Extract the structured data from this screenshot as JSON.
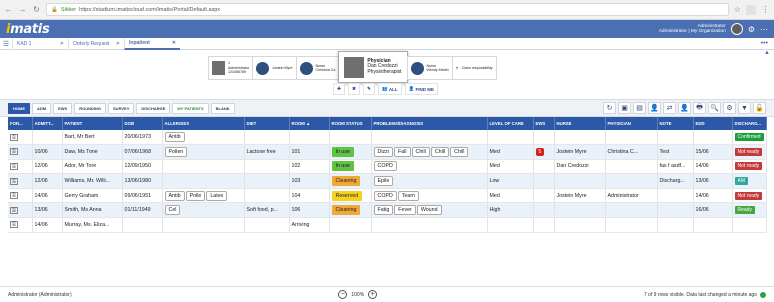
{
  "browser": {
    "secure_label": "Sikker",
    "url": "https://stadium.imatiscloud.com/Imatis/Portal/Default.aspx"
  },
  "app": {
    "logo_first": "i",
    "logo_rest": "matis",
    "user_name": "Administrator",
    "user_org": "Administrator | My Organization"
  },
  "tabs": [
    {
      "label": "KAD 1"
    },
    {
      "label": "Orderly Request"
    },
    {
      "label": "Inpatient"
    }
  ],
  "cards": [
    {
      "line1": "1",
      "line2": "Administrator",
      "line3": "123456789"
    },
    {
      "line1": "Jostein Myre",
      "line2": "",
      "line3": ""
    },
    {
      "line1": "Nurse",
      "line2": "Christina Ca",
      "line3": ""
    },
    {
      "line1": "Physician",
      "line2": "Dan Credozzi",
      "line3": "Physiotherapist"
    },
    {
      "line1": "Nurse",
      "line2": "Wendy Martin",
      "line3": ""
    },
    {
      "line1": "Claim responsibility",
      "line2": "",
      "line3": ""
    }
  ],
  "actions": {
    "all_label": "ALL",
    "find_label": "FIND ME"
  },
  "views": [
    "HOME",
    "ADM",
    "EWS",
    "ROUNDING",
    "SURVEY",
    "DISCHARGE",
    "MY PATIENTS",
    "BLANK"
  ],
  "columns": [
    "FOR...",
    "ADMITT...",
    "PATIENT",
    "DOB",
    "ALLERGIES",
    "DIET",
    "ROOM",
    "ROOM STATUS",
    "PROBLEMS/DIAGNOSIS",
    "LEVEL OF CARE",
    "EWS",
    "NURSE",
    "PHYSICIAN",
    "NOTE",
    "EDD",
    "DISCHARG..."
  ],
  "rows": [
    {
      "admitted": "",
      "patient": "Bart, Mr Bert",
      "dob": "20/06/1973",
      "allergies": [
        "Antib"
      ],
      "diet": "",
      "room": "",
      "room_status": "",
      "problems": [],
      "level": "",
      "ews": "",
      "nurse": "",
      "physician": "",
      "note": "",
      "edd": "",
      "discharge": "Confirmed"
    },
    {
      "admitted": "10/06",
      "patient": "Daw, Ms Tone",
      "dob": "07/06/1968",
      "allergies": [
        "Pollen"
      ],
      "diet": "Lactose free",
      "room": "101",
      "room_status": "In use",
      "problems": [
        "Dizzi",
        "Fall",
        "Chill",
        "Chill",
        "Chill"
      ],
      "level": "Med",
      "ews": "5",
      "nurse": "Jostein Myre",
      "physician": "Christina C...",
      "note": "Test",
      "edd": "15/06",
      "discharge": "Not ready"
    },
    {
      "admitted": "12/06",
      "patient": "Ador, Mr Tore",
      "dob": "12/09/1950",
      "allergies": [],
      "diet": "",
      "room": "102",
      "room_status": "In use",
      "problems": [
        "COPD"
      ],
      "level": "Med",
      "ews": "",
      "nurse": "Dan Credozzi",
      "physician": "",
      "note": "fas f asdf...",
      "edd": "14/06",
      "discharge": "Not ready"
    },
    {
      "admitted": "12/06",
      "patient": "Williams, Mr. Willi...",
      "dob": "13/06/1980",
      "allergies": [],
      "diet": "",
      "room": "103",
      "room_status": "Cleaning",
      "problems": [
        "Epile"
      ],
      "level": "Low",
      "ews": "",
      "nurse": "",
      "physician": "",
      "note": "Discharg...",
      "edd": "13/06",
      "discharge": "AM"
    },
    {
      "admitted": "14/06",
      "patient": "Gerry Graham",
      "dob": "09/06/1951",
      "allergies": [
        "Antib",
        "Polle",
        "Latex"
      ],
      "diet": "",
      "room": "104",
      "room_status": "Reserved",
      "problems": [
        "COPD",
        "Team"
      ],
      "level": "Med",
      "ews": "",
      "nurse": "Jostein Myre",
      "physician": "Administrator",
      "note": "",
      "edd": "14/06",
      "discharge": "Not ready"
    },
    {
      "admitted": "13/06",
      "patient": "Smith, Ms Anna",
      "dob": "01/11/1949",
      "allergies": [
        "Cel"
      ],
      "diet": "Soft food, p...",
      "room": "106",
      "room_status": "Cleaning",
      "problems": [
        "Fatig",
        "Fever",
        "Wound"
      ],
      "level": "High",
      "ews": "",
      "nurse": "",
      "physician": "",
      "note": "",
      "edd": "16/06",
      "discharge": "Ready"
    },
    {
      "admitted": "14/06",
      "patient": "Murray, Ms. Eliza...",
      "dob": "",
      "allergies": [],
      "diet": "",
      "room": "Arriving",
      "room_status": "",
      "problems": [],
      "level": "",
      "ews": "",
      "nurse": "",
      "physician": "",
      "note": "",
      "edd": "",
      "discharge": ""
    }
  ],
  "status": {
    "user": "Administrator (Administrator)",
    "zoom": "100%",
    "summary": "7 of 9 rows visible. Data last changed a minute ago"
  },
  "colors": {
    "brand": "#4a6fb3",
    "header": "#2d58a8",
    "in_use": "#61c342",
    "cleaning": "#f0a838",
    "reserved": "#f5d21e",
    "not_ready": "#c33a3a",
    "confirmed": "#1e9e3a"
  }
}
